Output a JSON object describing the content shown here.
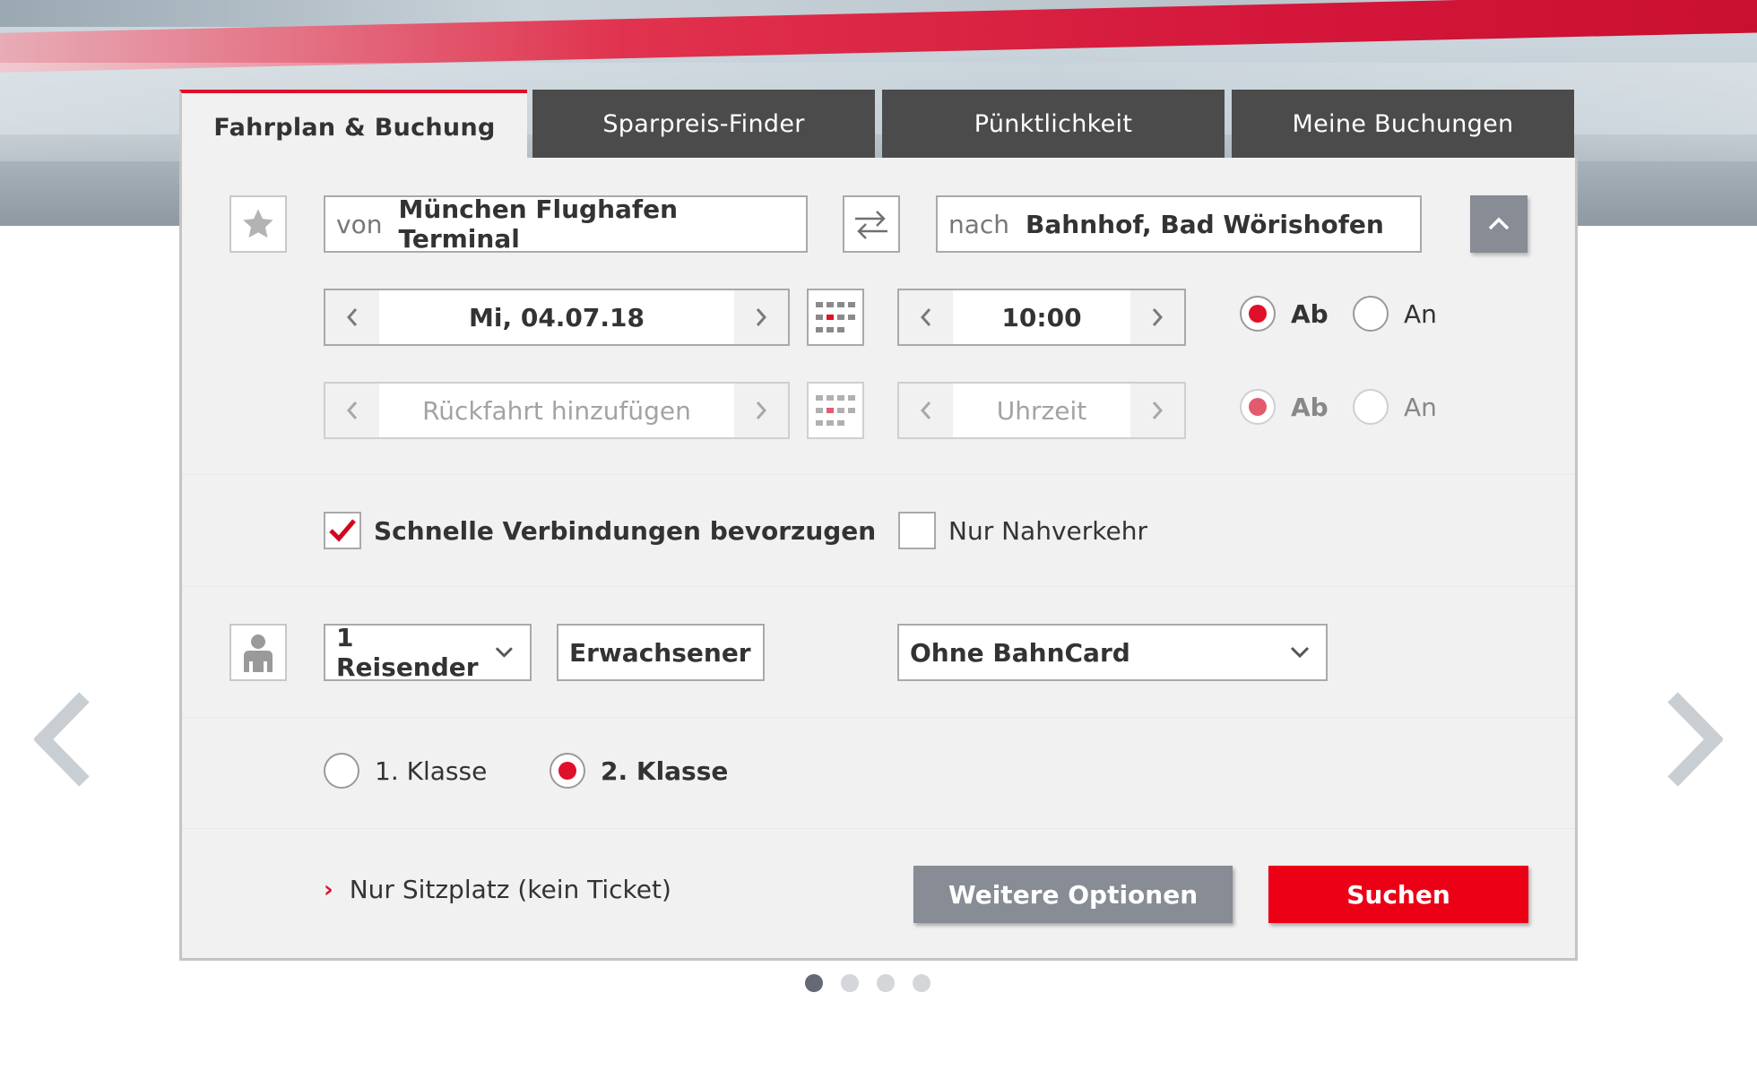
{
  "tabs": [
    {
      "label": "Fahrplan & Buchung",
      "active": true
    },
    {
      "label": "Sparpreis-Finder",
      "active": false
    },
    {
      "label": "Pünktlichkeit",
      "active": false
    },
    {
      "label": "Meine Buchungen",
      "active": false
    }
  ],
  "route": {
    "from_label": "von",
    "from_value": "München Flughafen Terminal",
    "to_label": "nach",
    "to_value": "Bahnhof, Bad Wörishofen"
  },
  "outbound": {
    "date": "Mi, 04.07.18",
    "time": "10:00",
    "dep_label": "Ab",
    "arr_label": "An",
    "selected": "Ab"
  },
  "return": {
    "date_placeholder": "Rückfahrt hinzufügen",
    "time_placeholder": "Uhrzeit",
    "dep_label": "Ab",
    "arr_label": "An",
    "selected": "Ab"
  },
  "options": {
    "fast_connections_label": "Schnelle Verbindungen bevorzugen",
    "fast_connections_checked": true,
    "local_only_label": "Nur Nahverkehr",
    "local_only_checked": false
  },
  "travellers": {
    "count": "1 Reisender",
    "type": "Erwachsener",
    "bahncard": "Ohne BahnCard"
  },
  "class": {
    "first_label": "1. Klasse",
    "second_label": "2. Klasse",
    "selected": "2. Klasse"
  },
  "actions": {
    "seat_only_link": "Nur Sitzplatz (kein Ticket)",
    "more_options": "Weitere Optionen",
    "search": "Suchen"
  },
  "carousel": {
    "pages": 4,
    "current": 1
  },
  "colors": {
    "accent_red": "#ec0016",
    "tab_dark": "#4b4b4b",
    "panel_bg": "#f1f1f1",
    "button_gray": "#878c95"
  }
}
